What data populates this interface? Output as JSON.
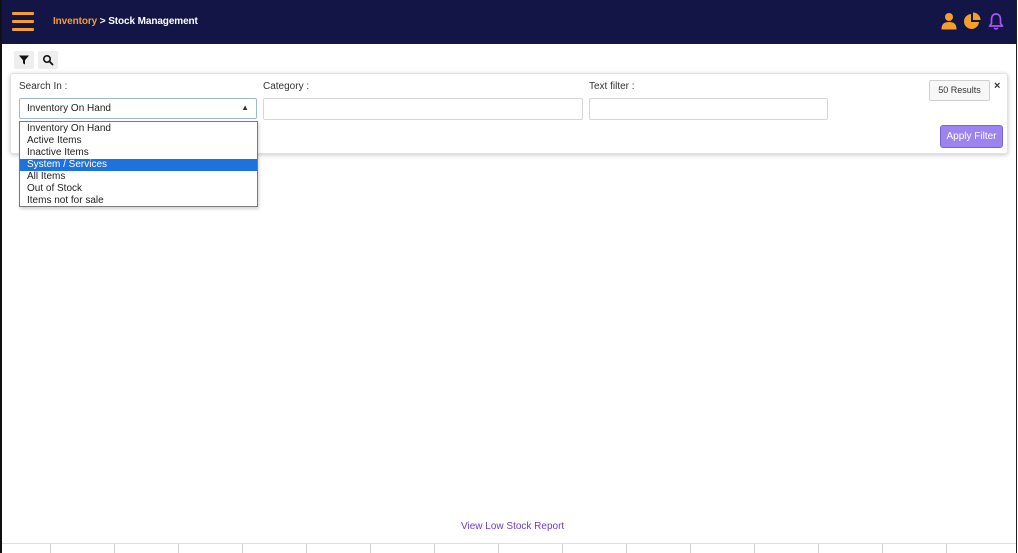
{
  "header": {
    "breadcrumb": {
      "parent": "Inventory",
      "separator": " > ",
      "current": "Stock Management"
    },
    "icons": [
      "user-icon",
      "pie-chart-icon",
      "bell-icon"
    ],
    "colors": {
      "bar": "#131547",
      "accent": "#f59e2c",
      "bell": "#a855f7"
    }
  },
  "toolbar": {
    "icons": [
      "filter-icon",
      "search-icon"
    ]
  },
  "filter": {
    "search_in_label": "Search In :",
    "search_in_value": "Inventory On Hand",
    "category_label": "Category :",
    "category_value": "",
    "text_filter_label": "Text filter :",
    "text_filter_value": "",
    "results_label": "50 Results",
    "close_label": "×",
    "apply_label": "Apply Filter"
  },
  "dropdown": {
    "options": [
      "Inventory On Hand",
      "Active Items",
      "Inactive Items",
      "System / Services",
      "All Items",
      "Out of Stock",
      "Items not for sale"
    ],
    "highlighted": "System / Services",
    "highlight_color": "#1e72dd"
  },
  "footer": {
    "link_label": "View Low Stock Report",
    "link_color": "#6f3bd6"
  }
}
